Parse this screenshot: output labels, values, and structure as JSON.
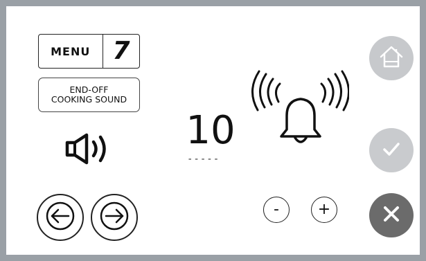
{
  "header": {
    "menu_label": "MENU",
    "menu_number": "7"
  },
  "title": {
    "line1": "END-OFF",
    "line2": "COOKING SOUND"
  },
  "value": {
    "current": "10",
    "dashes": "-----"
  },
  "controls": {
    "minus_label": "-",
    "plus_label": "+"
  },
  "icons": {
    "speaker": "speaker-icon",
    "bell": "bell-ringing-icon",
    "home": "home-icon",
    "confirm": "check-icon",
    "cancel": "close-icon",
    "left": "arrow-left-icon",
    "right": "arrow-right-icon"
  },
  "colors": {
    "frame": "#9aa0a6",
    "home_button": "#c7c9cc",
    "confirm_button": "#c9cbce",
    "cancel_button": "#6b6b6b"
  }
}
